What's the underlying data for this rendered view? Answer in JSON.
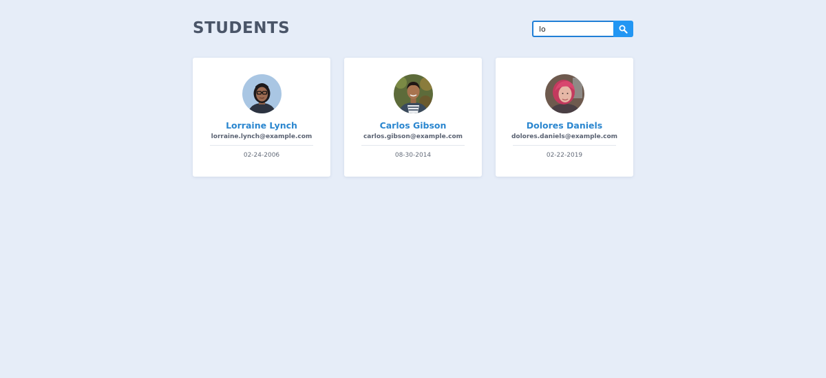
{
  "header": {
    "title": "STUDENTS"
  },
  "search": {
    "value": "lo",
    "placeholder": "",
    "button_icon": "search-icon"
  },
  "colors": {
    "background": "#e6edf8",
    "accent": "#2296f3",
    "name_color": "#2a86cf",
    "title_color": "#4a5568"
  },
  "students": [
    {
      "name": "Lorraine Lynch",
      "email": "lorraine.lynch@example.com",
      "date": "02-24-2006",
      "avatar": "avatar-woman-glasses"
    },
    {
      "name": "Carlos Gibson",
      "email": "carlos.gibson@example.com",
      "date": "08-30-2014",
      "avatar": "avatar-man-outdoors"
    },
    {
      "name": "Dolores Daniels",
      "email": "dolores.daniels@example.com",
      "date": "02-22-2019",
      "avatar": "avatar-woman-pink-hair"
    }
  ]
}
